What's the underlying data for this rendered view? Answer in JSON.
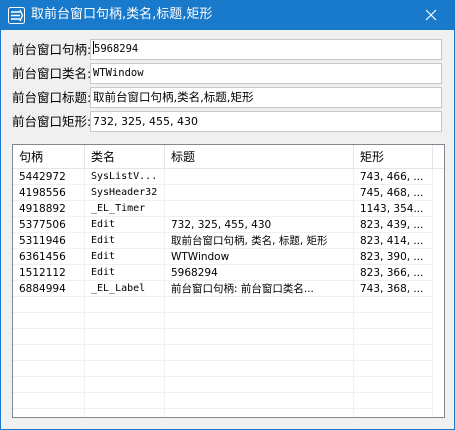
{
  "window": {
    "title": "取前台窗口句柄,类名,标题,矩形"
  },
  "fields": [
    {
      "label": "前台窗口句柄:",
      "value": "5968294"
    },
    {
      "label": "前台窗口类名:",
      "value": "WTWindow"
    },
    {
      "label": "前台窗口标题:",
      "value": "取前台窗口句柄,类名,标题,矩形"
    },
    {
      "label": "前台窗口矩形:",
      "value": "732, 325, 455, 430"
    }
  ],
  "list": {
    "columns": [
      "句柄",
      "类名",
      "标题",
      "矩形"
    ],
    "rows": [
      [
        "5442972",
        "SysListV...",
        "",
        "743, 466, ..."
      ],
      [
        "4198556",
        "SysHeader32",
        "",
        "745, 468, ..."
      ],
      [
        "4918892",
        "_EL_Timer",
        "",
        "1143, 354..."
      ],
      [
        "5377506",
        "Edit",
        "732, 325, 455, 430",
        "823, 439, ..."
      ],
      [
        "5311946",
        "Edit",
        "取前台窗口句柄, 类名, 标题, 矩形",
        "823, 414, ..."
      ],
      [
        "6361456",
        "Edit",
        "WTWindow",
        "823, 390, ..."
      ],
      [
        "1512112",
        "Edit",
        "5968294",
        "823, 366, ..."
      ],
      [
        "6884994",
        "_EL_Label",
        "前台窗口句柄: 前台窗口类名...",
        "743, 368, ..."
      ]
    ]
  },
  "colors": {
    "titlebar": "#1979ca",
    "title_text": "#ffffff",
    "window_bg": "#f0f0f0"
  },
  "icons": {
    "app": "app-icon",
    "close": "close-icon"
  }
}
